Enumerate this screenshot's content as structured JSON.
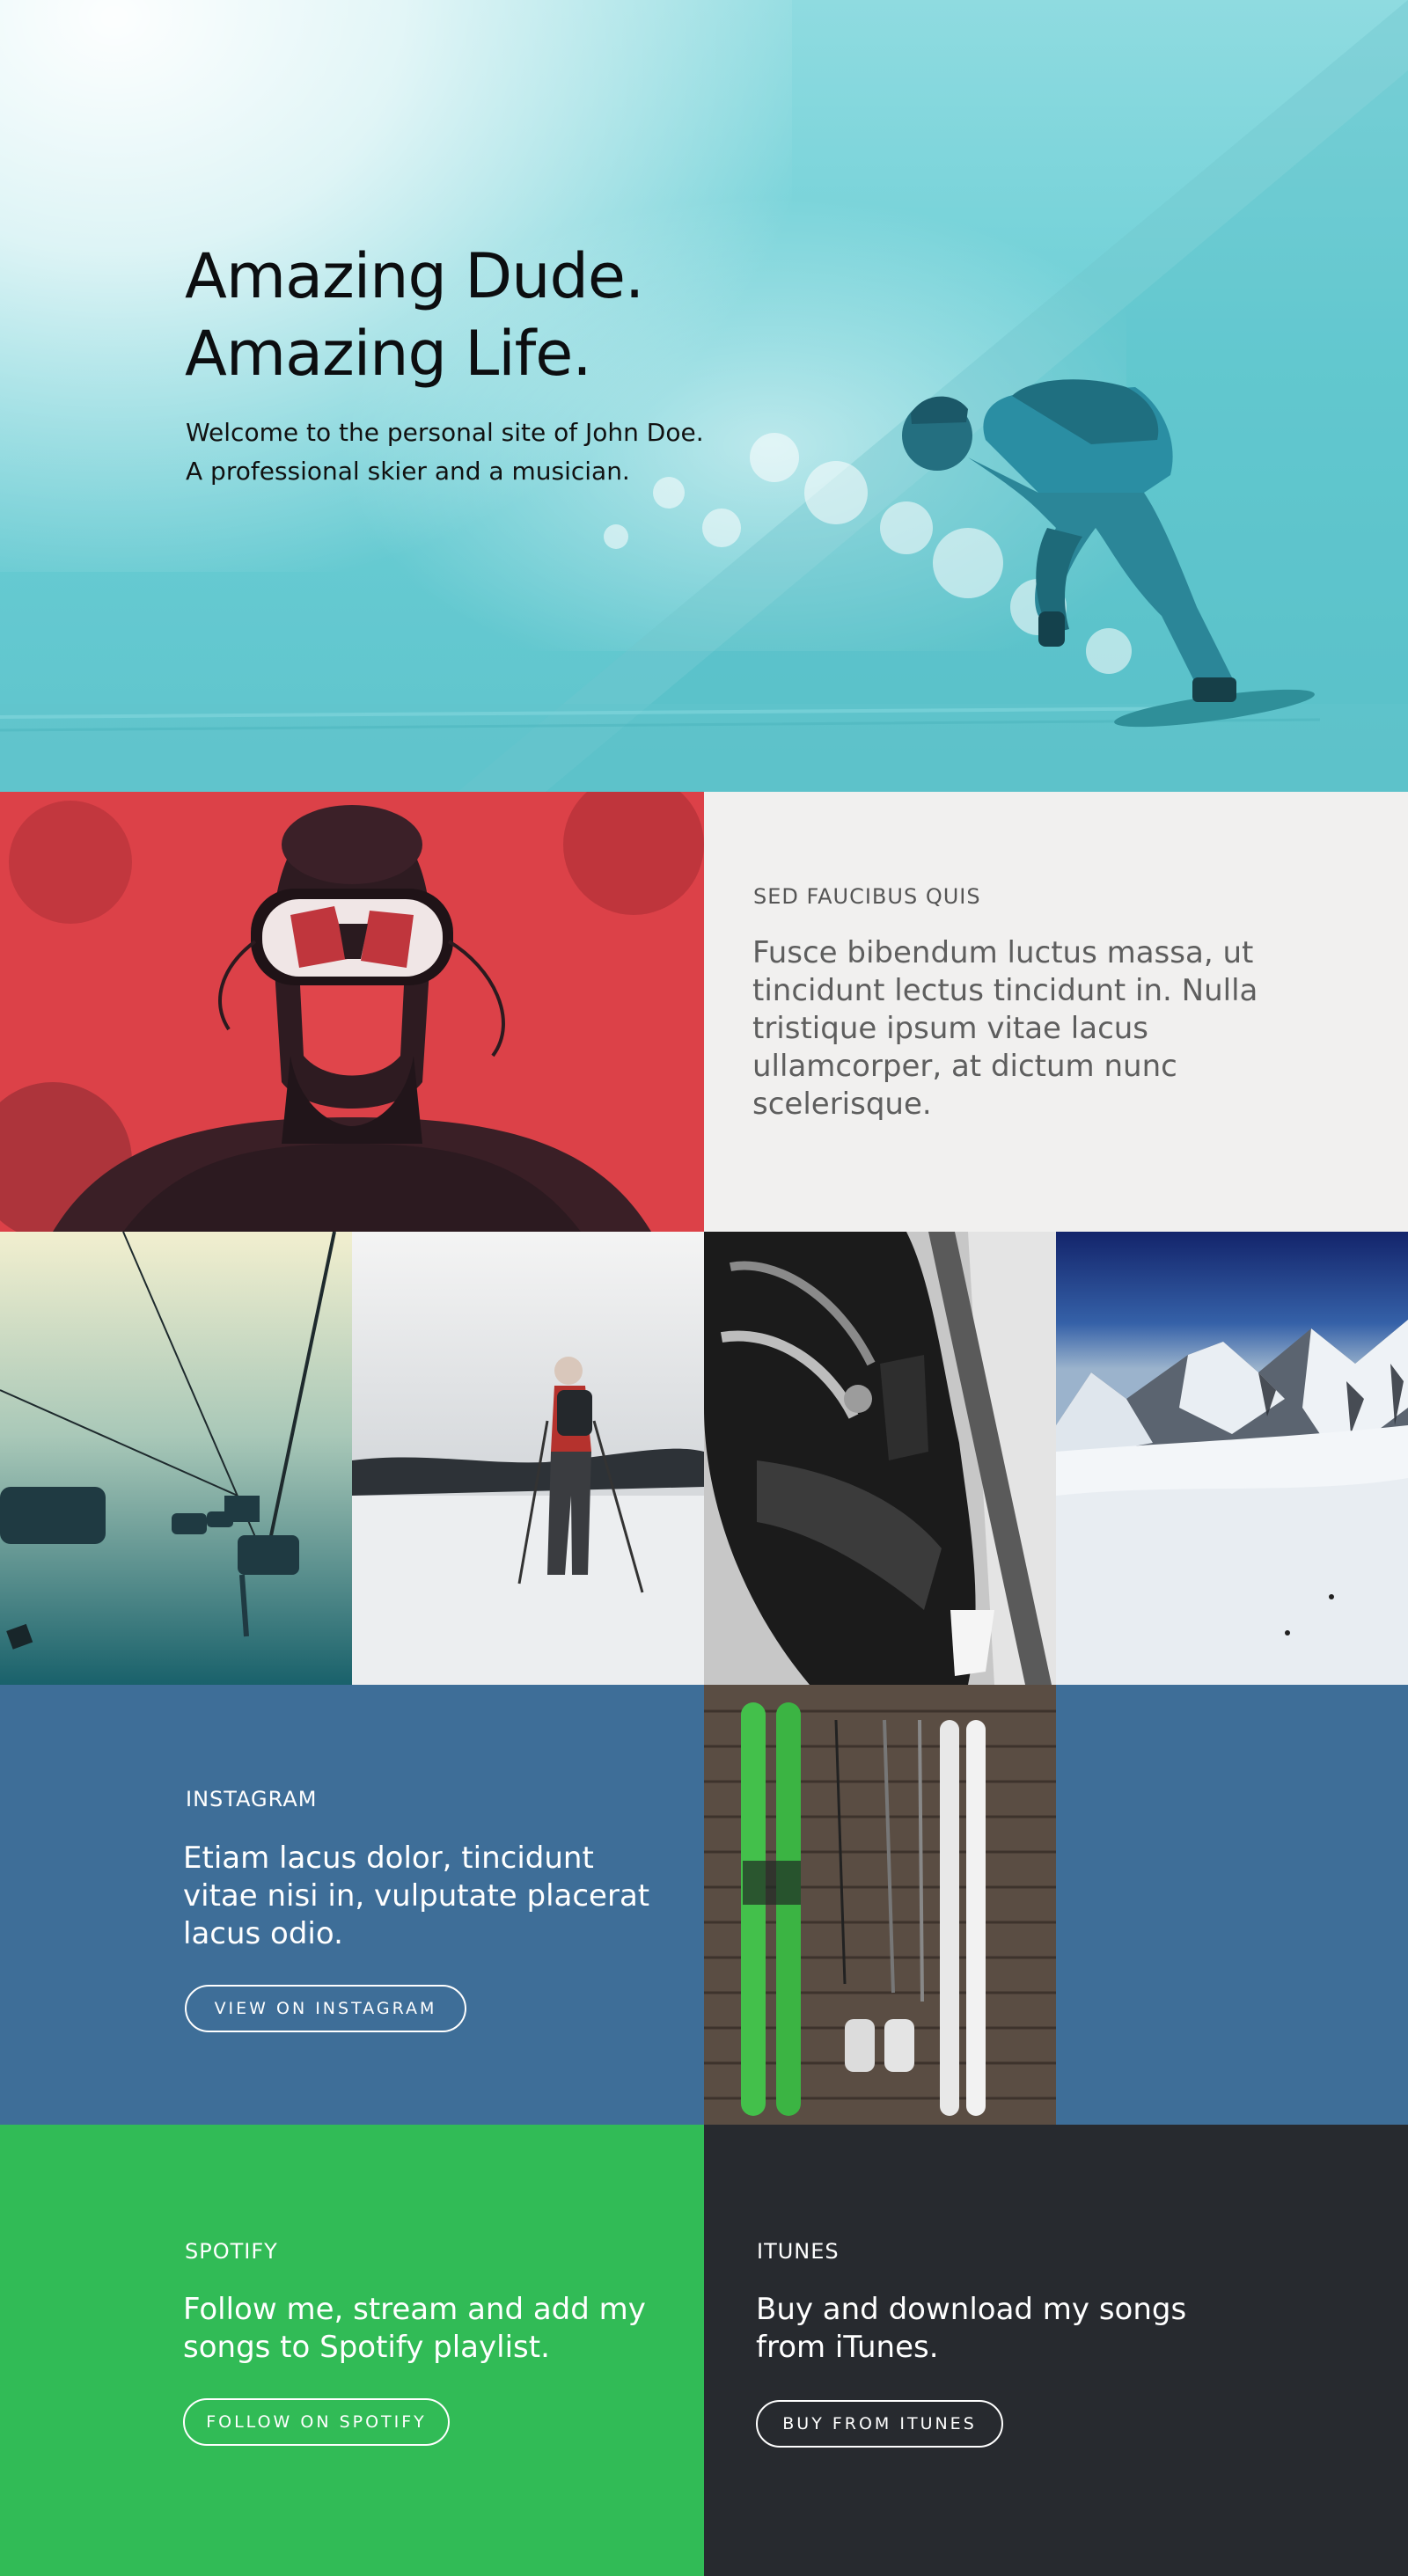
{
  "hero": {
    "title_line1": "Amazing Dude.",
    "title_line2": "Amazing Life.",
    "subtitle_line1": "Welcome to the personal site of John Doe.",
    "subtitle_line2": "A professional skier and a musician."
  },
  "about": {
    "eyebrow": "SED FAUCIBUS QUIS",
    "text": "Fusce bibendum luctus massa, ut tincidunt lectus tincidunt in. Nulla tristique ipsum vitae lacus ullamcorper, at dictum nunc scelerisque."
  },
  "instagram": {
    "eyebrow": "INSTAGRAM",
    "text": "Etiam lacus dolor, tincidunt vitae nisi in, vulputate placerat lacus odio.",
    "button_label": "VIEW ON INSTAGRAM"
  },
  "spotify": {
    "eyebrow": "SPOTIFY",
    "text": "Follow me, stream and add my songs to Spotify playlist.",
    "button_label": "FOLLOW ON SPOTIFY"
  },
  "itunes": {
    "eyebrow": "ITUNES",
    "text": "Buy and download my songs from iTunes.",
    "button_label": "BUY FROM ITUNES"
  },
  "colors": {
    "hero": "#6ccfd6",
    "portrait": "#d93f45",
    "about_bg": "#f1f0ef",
    "instagram": "#3e6e98",
    "spotify": "#31bb56",
    "itunes": "#272a2f"
  }
}
